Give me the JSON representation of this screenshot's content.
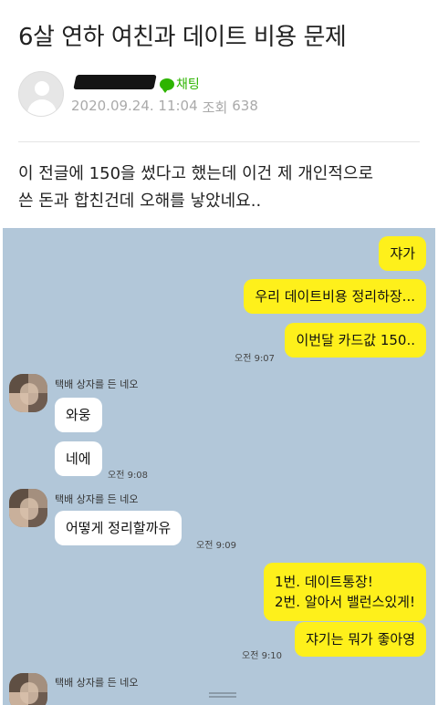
{
  "post": {
    "title": "6살 연하 여친과 데이트 비용 문제",
    "chat_label": "채팅",
    "date": "2020.09.24. 11:04",
    "views_label": "조회",
    "views": "638",
    "body_line1": "이 전글에 150을 썼다고 했는데 이건 제 개인적으로",
    "body_line2": "쓴 돈과 합친건데 오해를 낳았네요.."
  },
  "chat": {
    "sender_name": "택배 상자를 든 네오",
    "messages": {
      "m1": "쟈가",
      "m2": "우리 데이트비용 정리하장...",
      "m3": "이번달 카드값 150..",
      "t1": "오전 9:07",
      "m4": "와웅",
      "m5": "네에",
      "t2": "오전 9:08",
      "m6": "어떻게 정리할까유",
      "t3": "오전 9:09",
      "m7_line1": "1번. 데이트통장!",
      "m7_line2": "2번. 알아서 밸런스있게!",
      "m8": "쟈기는 뭐가 좋아영",
      "t4": "오전 9:10"
    }
  },
  "colors": {
    "chat_bg": "#b2c7d9",
    "my_bubble": "#fef01b",
    "other_bubble": "#ffffff",
    "chat_accent": "#2db400"
  }
}
